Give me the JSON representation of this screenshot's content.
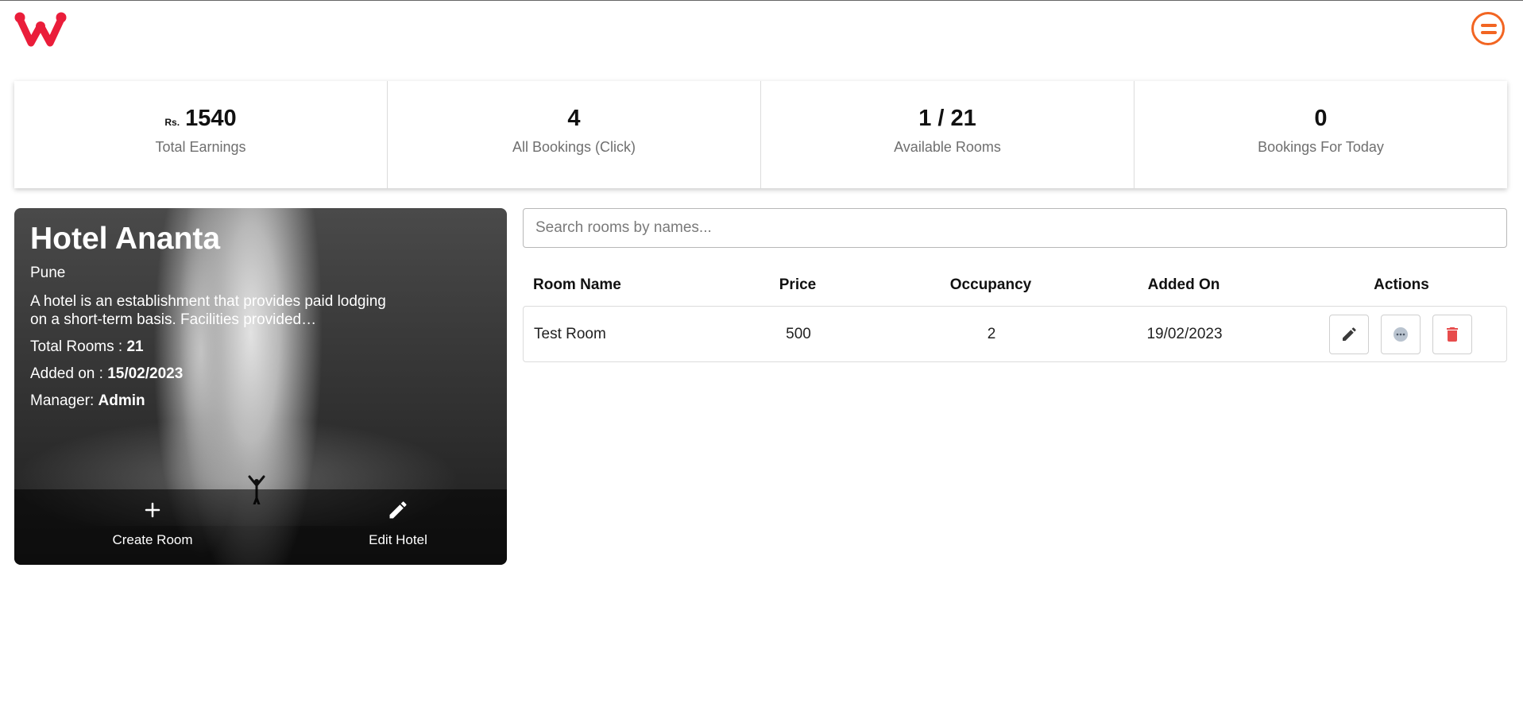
{
  "header": {
    "logo_icon": "logo-icon",
    "menu_icon": "menu-icon",
    "accent_color": "#f26522",
    "logo_color": "#ea1d3a"
  },
  "stats": {
    "earnings": {
      "currency": "Rs.",
      "value": "1540",
      "label": "Total Earnings"
    },
    "bookings": {
      "value": "4",
      "label": "All Bookings (Click)"
    },
    "rooms": {
      "value": "1 / 21",
      "label": "Available Rooms"
    },
    "today": {
      "value": "0",
      "label": "Bookings For Today"
    }
  },
  "hotel": {
    "name": "Hotel Ananta",
    "city": "Pune",
    "description": "A hotel is an establishment that provides paid lodging on a short-term basis. Facilities provided…",
    "total_rooms_label": "Total Rooms : ",
    "total_rooms": "21",
    "added_on_label": "Added on : ",
    "added_on": "15/02/2023",
    "manager_label": "Manager: ",
    "manager": "Admin",
    "actions": {
      "create_label": "Create Room",
      "edit_label": "Edit Hotel"
    }
  },
  "search": {
    "placeholder": "Search rooms by names...",
    "value": ""
  },
  "rooms_table": {
    "headers": [
      "Room Name",
      "Price",
      "Occupancy",
      "Added On",
      "Actions"
    ],
    "rows": [
      {
        "name": "Test Room",
        "price": "500",
        "occupancy": "2",
        "added_on": "19/02/2023"
      }
    ],
    "action_icons": [
      "pencil-icon",
      "more-icon",
      "trash-icon"
    ],
    "delete_color": "#e74c4c"
  }
}
